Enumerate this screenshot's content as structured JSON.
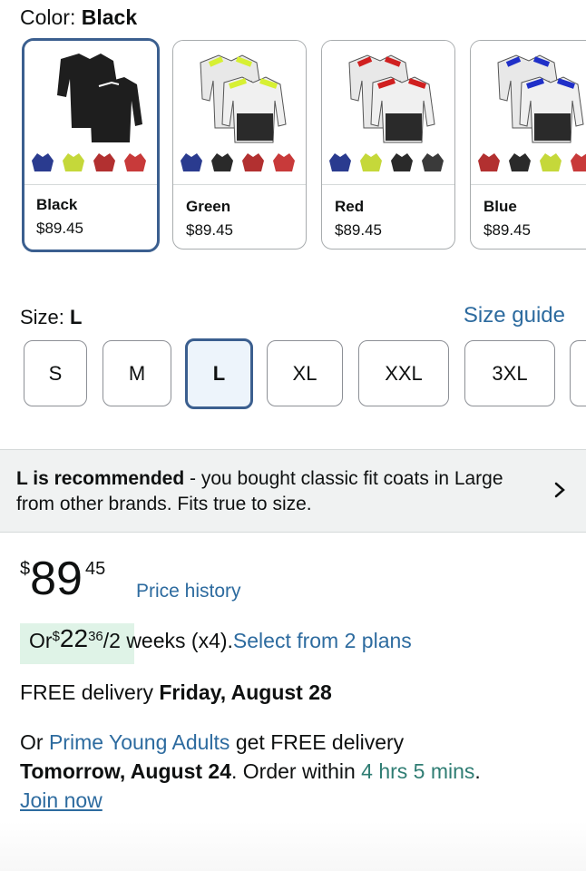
{
  "color": {
    "label": "Color:",
    "value": "Black"
  },
  "swatches": [
    {
      "name": "Black",
      "price": "$89.45",
      "accent": "#222222",
      "selected": true
    },
    {
      "name": "Green",
      "price": "$89.45",
      "accent": "#d7f033",
      "selected": false
    },
    {
      "name": "Red",
      "price": "$89.45",
      "accent": "#d02020",
      "selected": false
    },
    {
      "name": "Blue",
      "price": "$89.45",
      "accent": "#2030c8",
      "selected": false
    }
  ],
  "size": {
    "label": "Size:",
    "value": "L",
    "guide": "Size guide"
  },
  "sizes": [
    "S",
    "M",
    "L",
    "XL",
    "XXL",
    "3XL"
  ],
  "recommendation": {
    "bold": "L is recommended",
    "text": " - you bought classic fit coats in Large from other brands. Fits true to size."
  },
  "price": {
    "symbol": "$",
    "whole": "89",
    "fraction": "45",
    "history_link": "Price history"
  },
  "installment": {
    "prefix": "Or ",
    "symbol": "$",
    "whole": "22",
    "fraction": "36",
    "suffix": "/2 weeks (x4).",
    "link": "Select from 2 plans"
  },
  "delivery": {
    "prefix": "FREE delivery ",
    "date": "Friday, August 28"
  },
  "prime": {
    "prefix": "Or ",
    "link": "Prime Young Adults",
    "middle": " get FREE delivery",
    "date": "Tomorrow, August 24",
    "order": ". Order within ",
    "countdown": "4 hrs 5 mins",
    "end": ".",
    "join": "Join now"
  },
  "colors": {
    "link": "#2d6b9f",
    "selected_border": "#3b5f8f",
    "highlight": "#dff3e7",
    "countdown": "#2f7d73"
  }
}
